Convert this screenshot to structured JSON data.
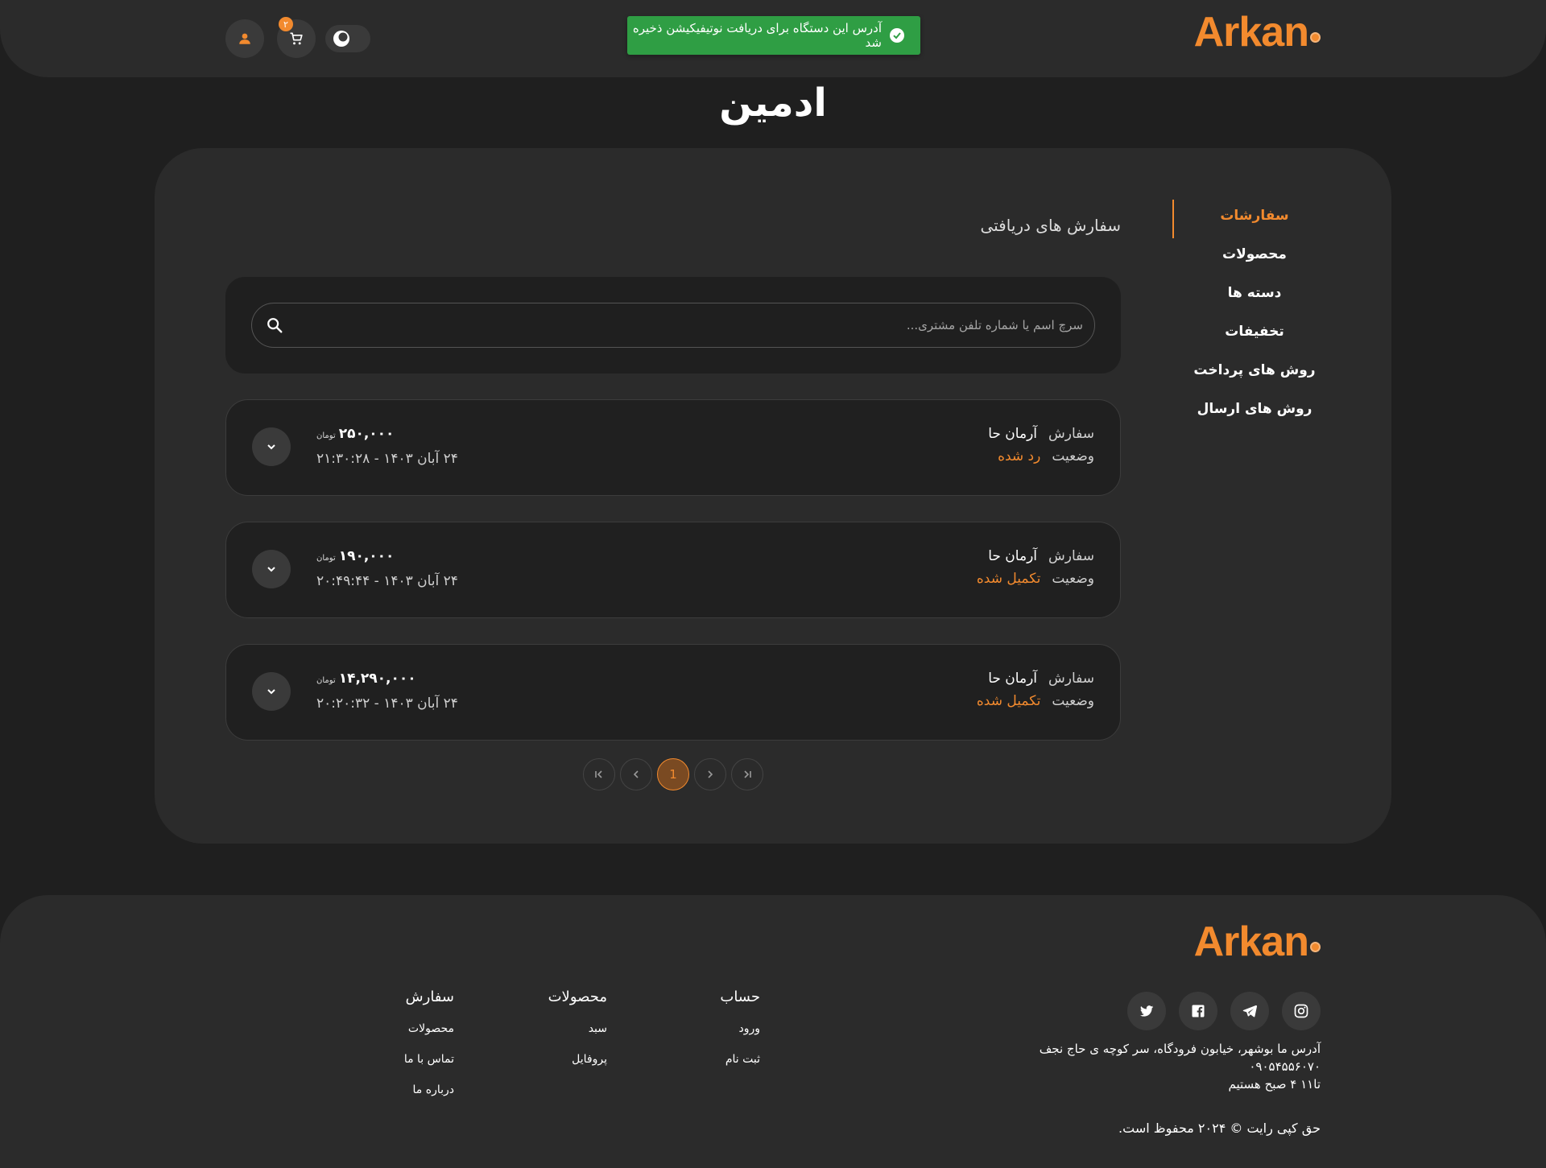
{
  "header": {
    "logo": "Arkan",
    "cart_count": "۲",
    "toast": "آدرس این دستگاه برای دریافت نوتیفیکیشن ذخیره شد"
  },
  "page_title": "ادمین",
  "sidebar": {
    "items": [
      {
        "label": "سفارشات",
        "active": true
      },
      {
        "label": "محصولات"
      },
      {
        "label": "دسته ها"
      },
      {
        "label": "تخفیفات"
      },
      {
        "label": "روش های پرداخت"
      },
      {
        "label": "روش های ارسال"
      }
    ]
  },
  "main": {
    "section_title": "سفارش های دریافتی",
    "search_placeholder": "سرچ اسم یا شماره تلفن مشتری...",
    "order_label": "سفارش",
    "status_label": "وضعیت",
    "currency": "تومان",
    "orders": [
      {
        "customer": "آرمان حا",
        "status": "رد شده",
        "price": "۲۵۰,۰۰۰",
        "date": "۲۴ آبان ۱۴۰۳ - ۲۱:۳۰:۲۸"
      },
      {
        "customer": "آرمان حا",
        "status": "تکمیل شده",
        "price": "۱۹۰,۰۰۰",
        "date": "۲۴ آبان ۱۴۰۳ - ۲۰:۴۹:۴۴"
      },
      {
        "customer": "آرمان حا",
        "status": "تکمیل شده",
        "price": "۱۴,۲۹۰,۰۰۰",
        "date": "۲۴ آبان ۱۴۰۳ - ۲۰:۲۰:۳۲"
      }
    ],
    "pagination": {
      "current": "1"
    }
  },
  "footer": {
    "logo": "Arkan",
    "address": "آدرس ما بوشهر، خیابون فرودگاه، سر کوچه ی حاج نجف",
    "phone": "۰۹۰۵۴۵۵۶۰۷۰",
    "hours": "تا۱۱ ۴ صبح هستیم",
    "copyright": "حق کپی رایت © ۲۰۲۴ محفوظ است.",
    "columns": [
      {
        "title": "حساب",
        "links": [
          "ورود",
          "ثبت نام"
        ]
      },
      {
        "title": "محصولات",
        "links": [
          "سبد",
          "پروفایل"
        ]
      },
      {
        "title": "سفارش",
        "links": [
          "محصولات",
          "تماس با ما",
          "درباره ما"
        ]
      }
    ]
  },
  "colors": {
    "accent": "#f28a2e",
    "toast_green": "#2f9e44",
    "background": "#1f1f1f",
    "card": "#2b2b2b"
  }
}
